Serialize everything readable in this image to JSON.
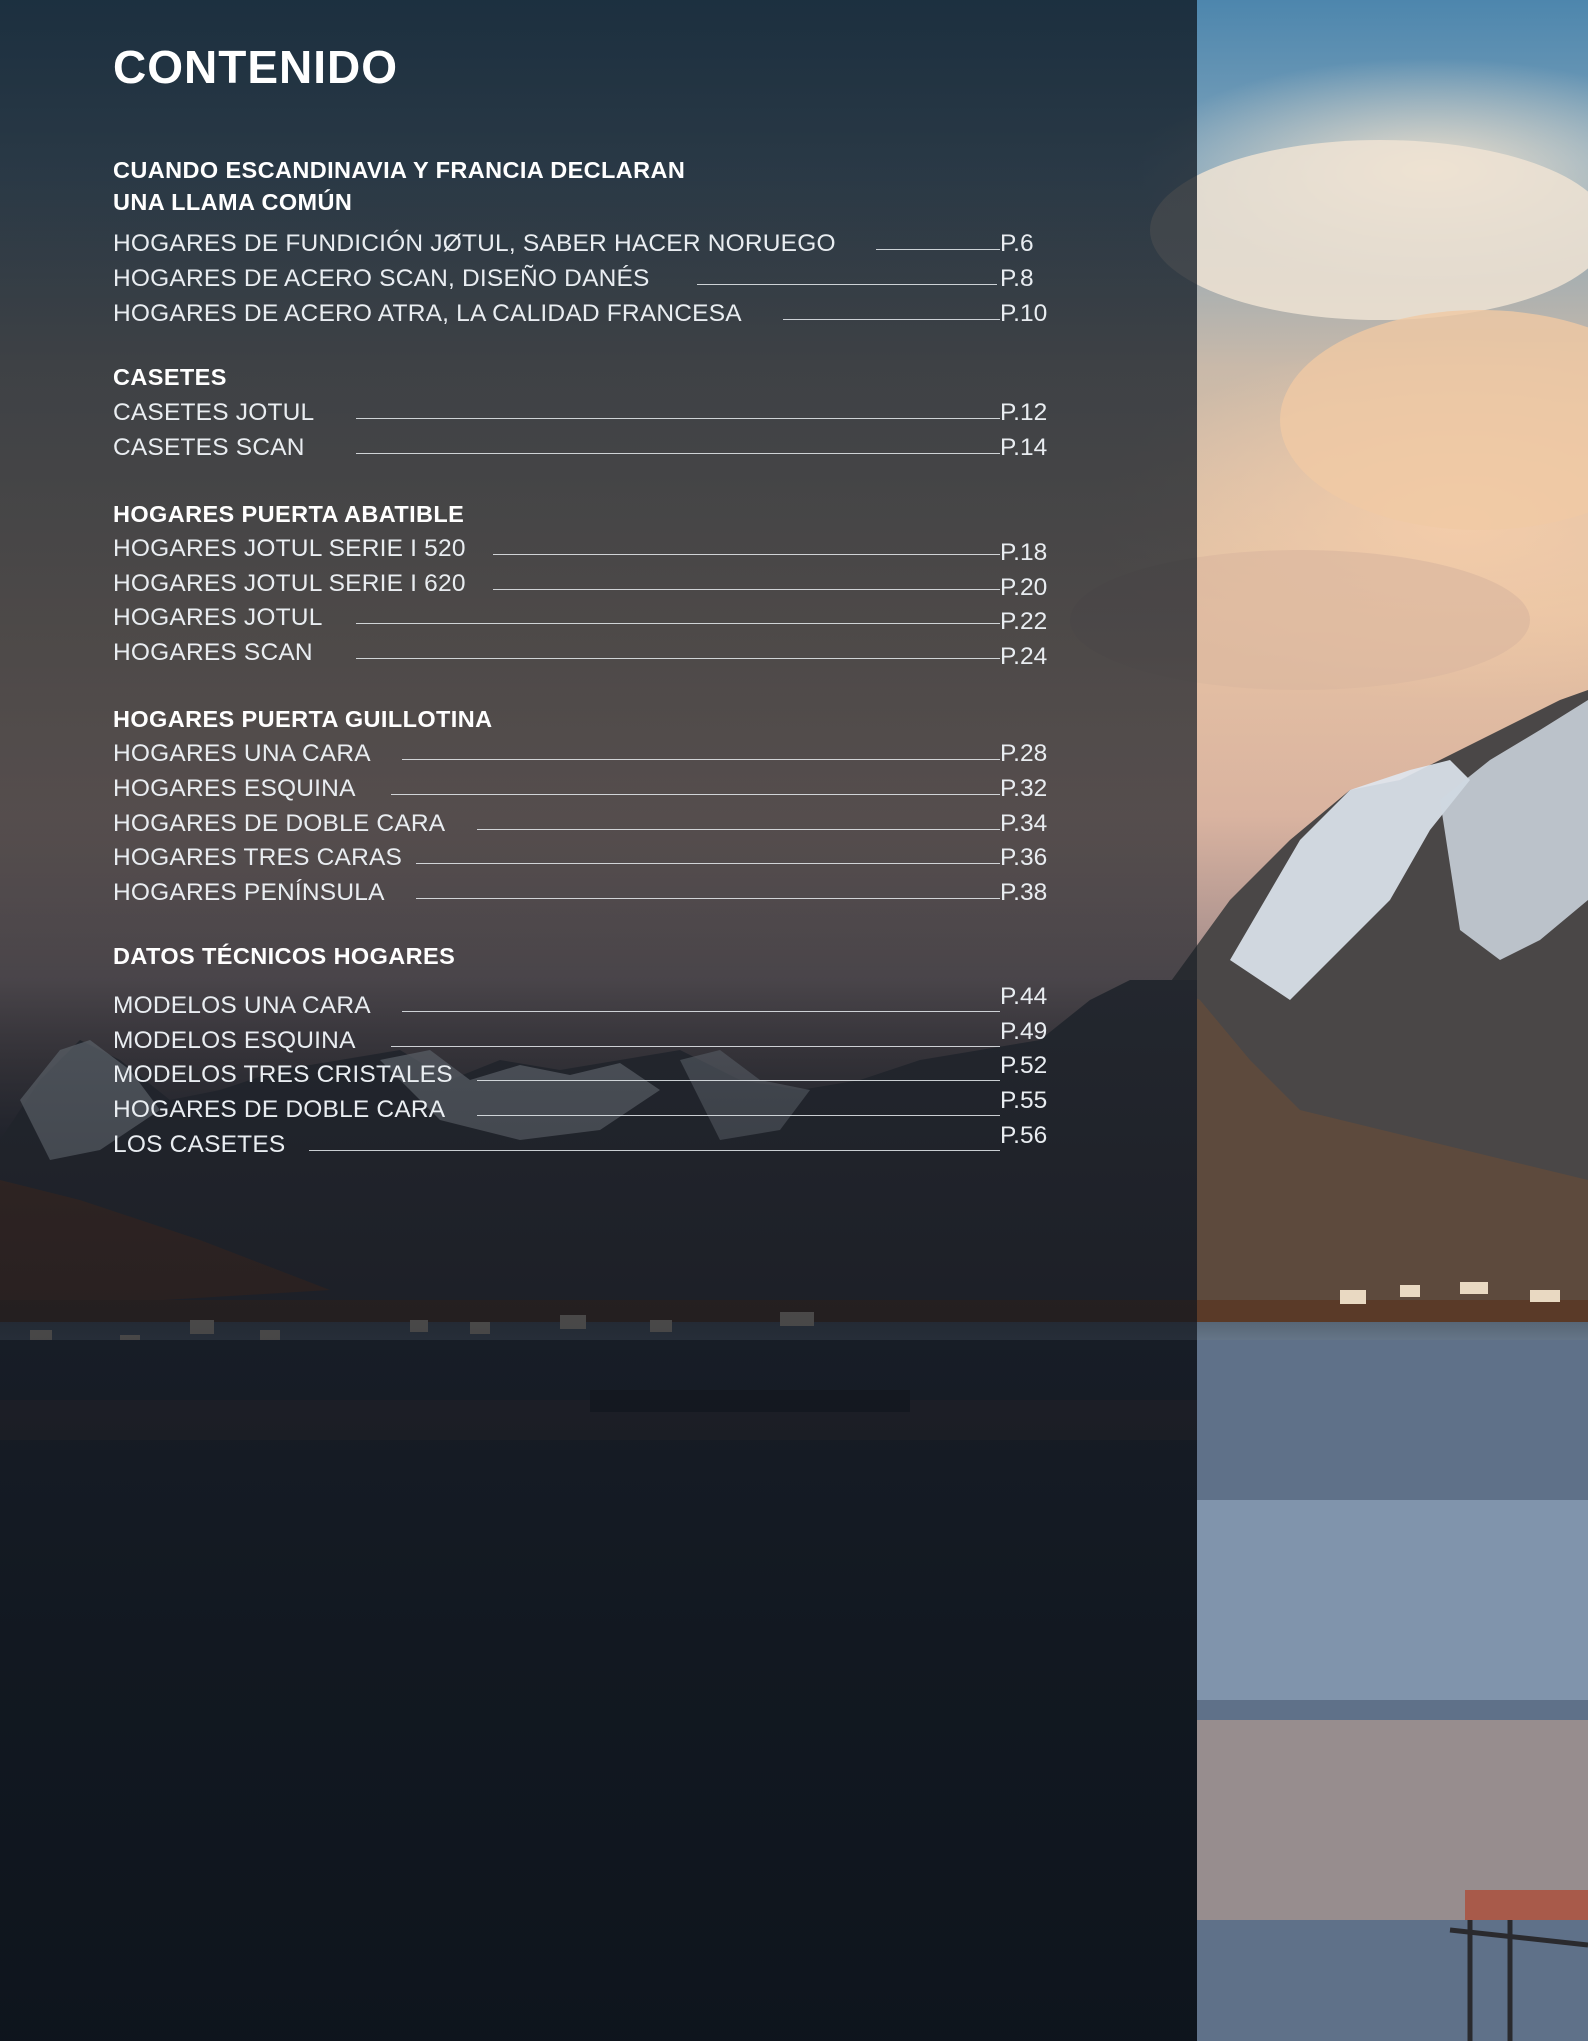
{
  "toc": {
    "title": "CONTENIDO",
    "sections": [
      {
        "heading_lines": [
          "CUANDO ESCANDINAVIA Y FRANCIA DECLARAN",
          "UNA LLAMA COMÚN"
        ],
        "entries": [
          {
            "label": "HOGARES DE FUNDICIÓN JØTUL, SABER HACER NORUEGO",
            "page": "P.6"
          },
          {
            "label": "HOGARES DE ACERO SCAN, DISEÑO DANÉS",
            "page": "P.8"
          },
          {
            "label": "HOGARES DE ACERO ATRA, LA CALIDAD FRANCESA",
            "page": "P.10"
          }
        ]
      },
      {
        "heading_lines": [
          "CASETES"
        ],
        "entries": [
          {
            "label": "CASETES JOTUL",
            "page": "P.12"
          },
          {
            "label": "CASETES SCAN",
            "page": "P.14"
          }
        ]
      },
      {
        "heading_lines": [
          "HOGARES PUERTA ABATIBLE"
        ],
        "entries": [
          {
            "label": "HOGARES JOTUL SERIE I 520",
            "page": "P.18"
          },
          {
            "label": "HOGARES JOTUL SERIE I 620",
            "page": "P.20"
          },
          {
            "label": "HOGARES JOTUL",
            "page": "P.22"
          },
          {
            "label": "HOGARES SCAN",
            "page": "P.24"
          }
        ]
      },
      {
        "heading_lines": [
          "HOGARES PUERTA GUILLOTINA"
        ],
        "entries": [
          {
            "label": "HOGARES UNA CARA",
            "page": "P.28"
          },
          {
            "label": "HOGARES ESQUINA",
            "page": "P.32"
          },
          {
            "label": "HOGARES DE DOBLE CARA",
            "page": "P.34"
          },
          {
            "label": "HOGARES TRES CARAS",
            "page": "P.36"
          },
          {
            "label": "HOGARES PENÍNSULA",
            "page": "P.38"
          }
        ]
      },
      {
        "heading_lines": [
          "DATOS TÉCNICOS HOGARES"
        ],
        "entries": [
          {
            "label": "MODELOS UNA CARA",
            "page": "P.44"
          },
          {
            "label": "MODELOS ESQUINA",
            "page": "P.49"
          },
          {
            "label": "MODELOS TRES CRISTALES",
            "page": "P.52"
          },
          {
            "label": "HOGARES DE DOBLE CARA",
            "page": "P.55"
          },
          {
            "label": "LOS CASETES",
            "page": "P.56"
          }
        ]
      }
    ]
  },
  "background": {
    "image": "fjord-mountain-village-photo",
    "panel_color": "#141c26",
    "text_color": "#ffffff"
  }
}
